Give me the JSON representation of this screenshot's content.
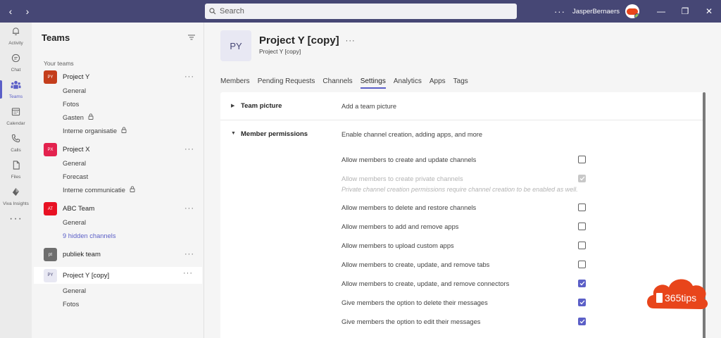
{
  "topbar": {
    "search_placeholder": "Search",
    "user_name": "JasperBernaers"
  },
  "rail": [
    {
      "label": "Activity",
      "icon": "bell-icon"
    },
    {
      "label": "Chat",
      "icon": "chat-icon"
    },
    {
      "label": "Teams",
      "icon": "teams-icon",
      "active": true
    },
    {
      "label": "Calendar",
      "icon": "calendar-icon"
    },
    {
      "label": "Calls",
      "icon": "phone-icon"
    },
    {
      "label": "Files",
      "icon": "file-icon"
    },
    {
      "label": "Viva Insights",
      "icon": "insights-icon"
    }
  ],
  "teams_panel": {
    "title": "Teams",
    "section_label": "Your teams",
    "teams": [
      {
        "initials": "PY",
        "name": "Project Y",
        "color": "#c43e1c",
        "channels": [
          {
            "name": "General"
          },
          {
            "name": "Fotos"
          },
          {
            "name": "Gasten",
            "locked": true
          },
          {
            "name": "Interne organisatie",
            "locked": true
          }
        ]
      },
      {
        "initials": "PX",
        "name": "Project X",
        "color": "#e3224e",
        "channels": [
          {
            "name": "General"
          },
          {
            "name": "Forecast"
          },
          {
            "name": "Interne communicatie",
            "locked": true
          }
        ]
      },
      {
        "initials": "AT",
        "name": "ABC Team",
        "color": "#e81123",
        "channels": [
          {
            "name": "General"
          },
          {
            "name": "9 hidden channels",
            "link": true
          }
        ]
      },
      {
        "initials": "pt",
        "name": "publiek team",
        "color": "#6e6e6e",
        "channels": []
      },
      {
        "initials": "PY",
        "name": "Project Y [copy]",
        "color": "#e8e8f3",
        "selected": true,
        "channels": [
          {
            "name": "General"
          },
          {
            "name": "Fotos"
          }
        ]
      }
    ]
  },
  "main": {
    "tile_initials": "PY",
    "team_title": "Project Y [copy]",
    "team_subtitle": "Project Y [copy]",
    "tabs": [
      "Members",
      "Pending Requests",
      "Channels",
      "Settings",
      "Analytics",
      "Apps",
      "Tags"
    ],
    "active_tab": "Settings",
    "team_picture": {
      "title": "Team picture",
      "desc": "Add a team picture"
    },
    "member_permissions": {
      "title": "Member permissions",
      "desc": "Enable channel creation, adding apps, and more",
      "items": [
        {
          "label": "Allow members to create and update channels",
          "checked": false
        },
        {
          "label": "Allow members to create private channels",
          "checked": true,
          "disabled": true,
          "note": "Private channel creation permissions require channel creation to be enabled as well."
        },
        {
          "label": "Allow members to delete and restore channels",
          "checked": false
        },
        {
          "label": "Allow members to add and remove apps",
          "checked": false
        },
        {
          "label": "Allow members to upload custom apps",
          "checked": false
        },
        {
          "label": "Allow members to create, update, and remove tabs",
          "checked": false
        },
        {
          "label": "Allow members to create, update, and remove connectors",
          "checked": true
        },
        {
          "label": "Give members the option to delete their messages",
          "checked": true
        },
        {
          "label": "Give members the option to edit their messages",
          "checked": true
        }
      ]
    }
  },
  "badge": {
    "text": "365tips"
  }
}
